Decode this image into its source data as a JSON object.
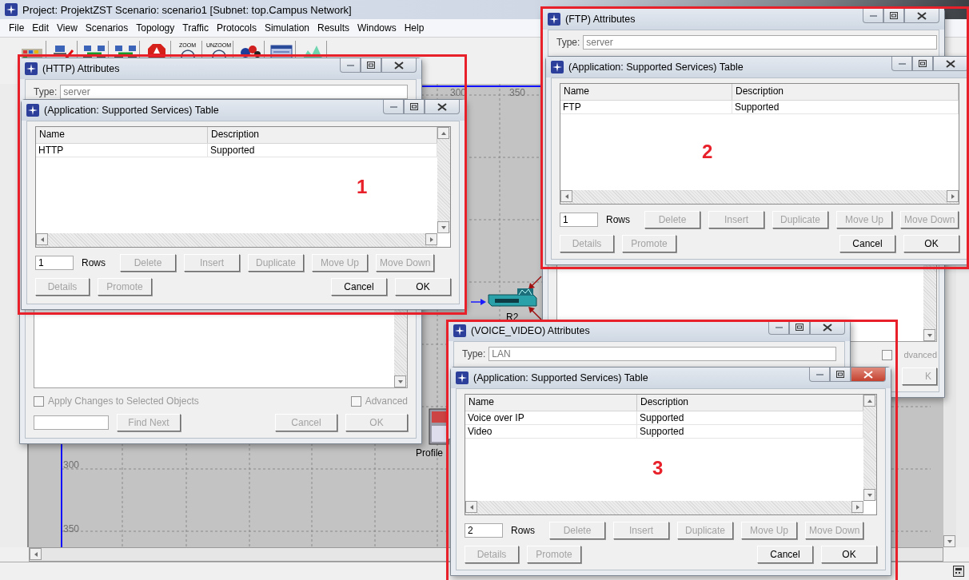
{
  "app": {
    "title": "Project: ProjektZST Scenario: scenario1  [Subnet: top.Campus Network]",
    "menu": [
      "File",
      "Edit",
      "View",
      "Scenarios",
      "Topology",
      "Traffic",
      "Protocols",
      "Simulation",
      "Results",
      "Windows",
      "Help"
    ],
    "toolbar": [
      {
        "kind": "palette"
      },
      {
        "kind": "failure"
      },
      {
        "kind": "link"
      },
      {
        "kind": "link"
      },
      {
        "kind": "stop"
      },
      {
        "kind": "zoom",
        "label": "ZOOM"
      },
      {
        "kind": "zoom",
        "label": "UNZOOM"
      },
      {
        "kind": "animate"
      },
      {
        "kind": "window"
      },
      {
        "kind": "chart"
      }
    ],
    "canvas": {
      "top_ruler": [
        "300",
        "350"
      ],
      "left_ruler": [
        "300",
        "350"
      ],
      "nodes": [
        {
          "kind": "router",
          "label": "R2"
        },
        {
          "kind": "profile",
          "label": "Profile"
        }
      ]
    }
  },
  "dialogs": [
    {
      "annotation": "1",
      "attributes": {
        "title": "(HTTP) Attributes",
        "type_label": "Type:",
        "type_value": "server",
        "footer": {
          "apply": {
            "label": "Apply Changes to Selected Objects",
            "checked": false
          },
          "advanced": {
            "label": "Advanced",
            "checked": false
          },
          "find_button": {
            "label": "Find Next",
            "disabled": true
          },
          "buttons": [
            {
              "label": "Cancel",
              "disabled": true
            },
            {
              "label": "OK",
              "disabled": true
            }
          ]
        }
      },
      "table": {
        "title": "(Application: Supported Services) Table",
        "active": false,
        "columns": [
          "Name",
          "Description"
        ],
        "rows": [
          [
            "HTTP",
            "Supported"
          ]
        ],
        "row_count": "1",
        "rows_label": "Rows",
        "edit_buttons": [
          {
            "label": "Delete",
            "disabled": true
          },
          {
            "label": "Insert",
            "disabled": true
          },
          {
            "label": "Duplicate",
            "disabled": true
          },
          {
            "label": "Move Up",
            "disabled": true
          },
          {
            "label": "Move Down",
            "disabled": true
          }
        ],
        "left_buttons": [
          {
            "label": "Details",
            "disabled": true
          },
          {
            "label": "Promote",
            "disabled": true
          }
        ],
        "right_buttons": [
          {
            "label": "Cancel",
            "disabled": false
          },
          {
            "label": "OK",
            "disabled": false
          }
        ]
      }
    },
    {
      "annotation": "2",
      "attributes": {
        "title": "(FTP) Attributes",
        "type_label": "Type:",
        "type_value": "server",
        "footer": {
          "advanced": {
            "label": "dvanced",
            "checked": false
          },
          "buttons": [
            {
              "label": "K",
              "disabled": true
            }
          ]
        }
      },
      "table": {
        "title": "(Application: Supported Services) Table",
        "active": false,
        "columns": [
          "Name",
          "Description"
        ],
        "rows": [
          [
            "FTP",
            "Supported"
          ]
        ],
        "row_count": "1",
        "rows_label": "Rows",
        "edit_buttons": [
          {
            "label": "Delete",
            "disabled": true
          },
          {
            "label": "Insert",
            "disabled": true
          },
          {
            "label": "Duplicate",
            "disabled": true
          },
          {
            "label": "Move Up",
            "disabled": true
          },
          {
            "label": "Move Down",
            "disabled": true
          }
        ],
        "left_buttons": [
          {
            "label": "Details",
            "disabled": true
          },
          {
            "label": "Promote",
            "disabled": true
          }
        ],
        "right_buttons": [
          {
            "label": "Cancel",
            "disabled": false
          },
          {
            "label": "OK",
            "disabled": false
          }
        ]
      }
    },
    {
      "annotation": "3",
      "attributes": {
        "title": "(VOICE_VIDEO) Attributes",
        "type_label": "Type:",
        "type_value": "LAN"
      },
      "table": {
        "title": "(Application: Supported Services) Table",
        "active": true,
        "columns": [
          "Name",
          "Description"
        ],
        "rows": [
          [
            "Voice over IP",
            "Supported"
          ],
          [
            "Video",
            "Supported"
          ]
        ],
        "row_count": "2",
        "rows_label": "Rows",
        "edit_buttons": [
          {
            "label": "Delete",
            "disabled": true
          },
          {
            "label": "Insert",
            "disabled": true
          },
          {
            "label": "Duplicate",
            "disabled": true
          },
          {
            "label": "Move Up",
            "disabled": true
          },
          {
            "label": "Move Down",
            "disabled": true
          }
        ],
        "left_buttons": [
          {
            "label": "Details",
            "disabled": true
          },
          {
            "label": "Promote",
            "disabled": true
          }
        ],
        "right_buttons": [
          {
            "label": "Cancel",
            "disabled": false
          },
          {
            "label": "OK",
            "disabled": false
          }
        ]
      }
    }
  ]
}
